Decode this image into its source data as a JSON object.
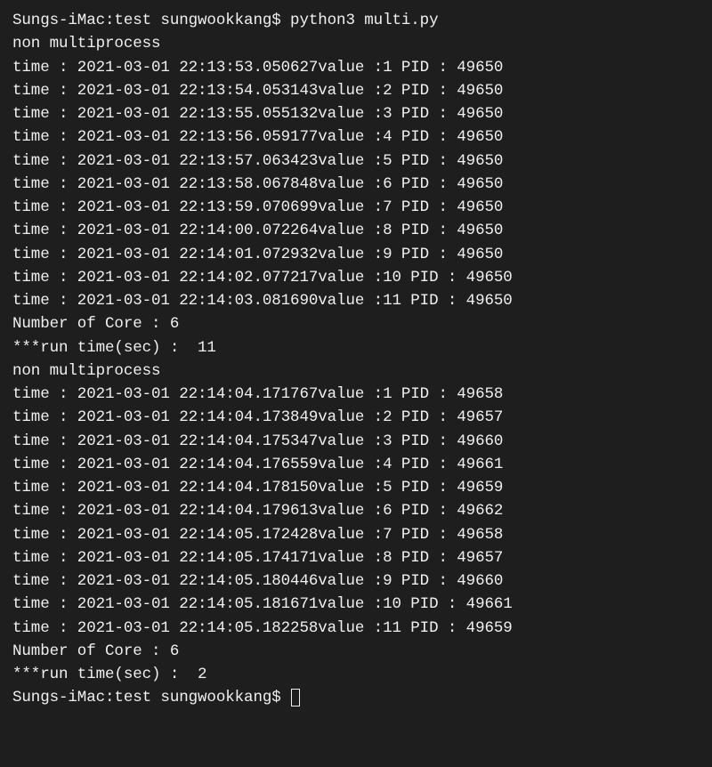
{
  "prompt1": "Sungs-iMac:test sungwookkang$ python3 multi.py",
  "header1": "non multiprocess",
  "run1": [
    "time : 2021-03-01 22:13:53.050627value :1 PID : 49650",
    "time : 2021-03-01 22:13:54.053143value :2 PID : 49650",
    "time : 2021-03-01 22:13:55.055132value :3 PID : 49650",
    "time : 2021-03-01 22:13:56.059177value :4 PID : 49650",
    "time : 2021-03-01 22:13:57.063423value :5 PID : 49650",
    "time : 2021-03-01 22:13:58.067848value :6 PID : 49650",
    "time : 2021-03-01 22:13:59.070699value :7 PID : 49650",
    "time : 2021-03-01 22:14:00.072264value :8 PID : 49650",
    "time : 2021-03-01 22:14:01.072932value :9 PID : 49650",
    "time : 2021-03-01 22:14:02.077217value :10 PID : 49650",
    "time : 2021-03-01 22:14:03.081690value :11 PID : 49650"
  ],
  "cores1": "Number of Core : 6",
  "runtime1": "***run time(sec) :  11",
  "header2": "non multiprocess",
  "run2": [
    "time : 2021-03-01 22:14:04.171767value :1 PID : 49658",
    "time : 2021-03-01 22:14:04.173849value :2 PID : 49657",
    "time : 2021-03-01 22:14:04.175347value :3 PID : 49660",
    "time : 2021-03-01 22:14:04.176559value :4 PID : 49661",
    "time : 2021-03-01 22:14:04.178150value :5 PID : 49659",
    "time : 2021-03-01 22:14:04.179613value :6 PID : 49662",
    "time : 2021-03-01 22:14:05.172428value :7 PID : 49658",
    "time : 2021-03-01 22:14:05.174171value :8 PID : 49657",
    "time : 2021-03-01 22:14:05.180446value :9 PID : 49660",
    "time : 2021-03-01 22:14:05.181671value :10 PID : 49661",
    "time : 2021-03-01 22:14:05.182258value :11 PID : 49659"
  ],
  "cores2": "Number of Core : 6",
  "runtime2": "***run time(sec) :  2",
  "prompt2": "Sungs-iMac:test sungwookkang$ "
}
